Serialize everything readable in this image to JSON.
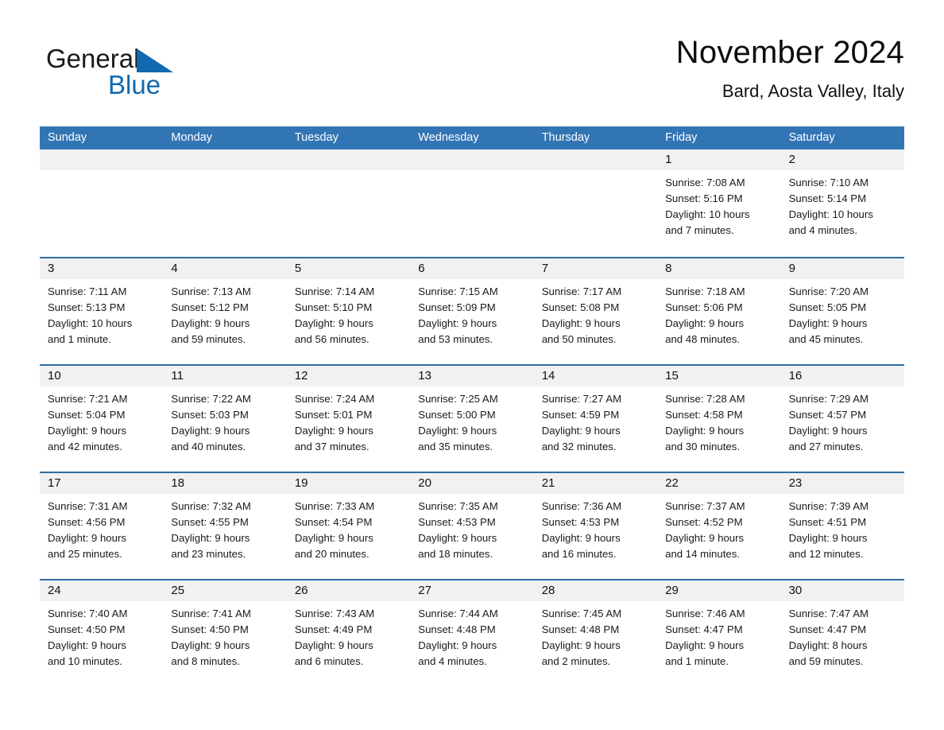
{
  "logo": {
    "word1": "General",
    "word2": "Blue",
    "triangle_icon": "blue-triangle-icon",
    "blue": "#1169b0"
  },
  "header": {
    "title": "November 2024",
    "subtitle": "Bard, Aosta Valley, Italy"
  },
  "theme": {
    "header_blue": "#3275b4",
    "row_rule_blue": "#2e6da4",
    "daynum_band": "#f1f1f1",
    "text": "#1a1a1a"
  },
  "weekdays": [
    "Sunday",
    "Monday",
    "Tuesday",
    "Wednesday",
    "Thursday",
    "Friday",
    "Saturday"
  ],
  "weeks": [
    [
      {
        "day": "",
        "lines": []
      },
      {
        "day": "",
        "lines": []
      },
      {
        "day": "",
        "lines": []
      },
      {
        "day": "",
        "lines": []
      },
      {
        "day": "",
        "lines": []
      },
      {
        "day": "1",
        "lines": [
          "Sunrise: 7:08 AM",
          "Sunset: 5:16 PM",
          "Daylight: 10 hours",
          "and 7 minutes."
        ]
      },
      {
        "day": "2",
        "lines": [
          "Sunrise: 7:10 AM",
          "Sunset: 5:14 PM",
          "Daylight: 10 hours",
          "and 4 minutes."
        ]
      }
    ],
    [
      {
        "day": "3",
        "lines": [
          "Sunrise: 7:11 AM",
          "Sunset: 5:13 PM",
          "Daylight: 10 hours",
          "and 1 minute."
        ]
      },
      {
        "day": "4",
        "lines": [
          "Sunrise: 7:13 AM",
          "Sunset: 5:12 PM",
          "Daylight: 9 hours",
          "and 59 minutes."
        ]
      },
      {
        "day": "5",
        "lines": [
          "Sunrise: 7:14 AM",
          "Sunset: 5:10 PM",
          "Daylight: 9 hours",
          "and 56 minutes."
        ]
      },
      {
        "day": "6",
        "lines": [
          "Sunrise: 7:15 AM",
          "Sunset: 5:09 PM",
          "Daylight: 9 hours",
          "and 53 minutes."
        ]
      },
      {
        "day": "7",
        "lines": [
          "Sunrise: 7:17 AM",
          "Sunset: 5:08 PM",
          "Daylight: 9 hours",
          "and 50 minutes."
        ]
      },
      {
        "day": "8",
        "lines": [
          "Sunrise: 7:18 AM",
          "Sunset: 5:06 PM",
          "Daylight: 9 hours",
          "and 48 minutes."
        ]
      },
      {
        "day": "9",
        "lines": [
          "Sunrise: 7:20 AM",
          "Sunset: 5:05 PM",
          "Daylight: 9 hours",
          "and 45 minutes."
        ]
      }
    ],
    [
      {
        "day": "10",
        "lines": [
          "Sunrise: 7:21 AM",
          "Sunset: 5:04 PM",
          "Daylight: 9 hours",
          "and 42 minutes."
        ]
      },
      {
        "day": "11",
        "lines": [
          "Sunrise: 7:22 AM",
          "Sunset: 5:03 PM",
          "Daylight: 9 hours",
          "and 40 minutes."
        ]
      },
      {
        "day": "12",
        "lines": [
          "Sunrise: 7:24 AM",
          "Sunset: 5:01 PM",
          "Daylight: 9 hours",
          "and 37 minutes."
        ]
      },
      {
        "day": "13",
        "lines": [
          "Sunrise: 7:25 AM",
          "Sunset: 5:00 PM",
          "Daylight: 9 hours",
          "and 35 minutes."
        ]
      },
      {
        "day": "14",
        "lines": [
          "Sunrise: 7:27 AM",
          "Sunset: 4:59 PM",
          "Daylight: 9 hours",
          "and 32 minutes."
        ]
      },
      {
        "day": "15",
        "lines": [
          "Sunrise: 7:28 AM",
          "Sunset: 4:58 PM",
          "Daylight: 9 hours",
          "and 30 minutes."
        ]
      },
      {
        "day": "16",
        "lines": [
          "Sunrise: 7:29 AM",
          "Sunset: 4:57 PM",
          "Daylight: 9 hours",
          "and 27 minutes."
        ]
      }
    ],
    [
      {
        "day": "17",
        "lines": [
          "Sunrise: 7:31 AM",
          "Sunset: 4:56 PM",
          "Daylight: 9 hours",
          "and 25 minutes."
        ]
      },
      {
        "day": "18",
        "lines": [
          "Sunrise: 7:32 AM",
          "Sunset: 4:55 PM",
          "Daylight: 9 hours",
          "and 23 minutes."
        ]
      },
      {
        "day": "19",
        "lines": [
          "Sunrise: 7:33 AM",
          "Sunset: 4:54 PM",
          "Daylight: 9 hours",
          "and 20 minutes."
        ]
      },
      {
        "day": "20",
        "lines": [
          "Sunrise: 7:35 AM",
          "Sunset: 4:53 PM",
          "Daylight: 9 hours",
          "and 18 minutes."
        ]
      },
      {
        "day": "21",
        "lines": [
          "Sunrise: 7:36 AM",
          "Sunset: 4:53 PM",
          "Daylight: 9 hours",
          "and 16 minutes."
        ]
      },
      {
        "day": "22",
        "lines": [
          "Sunrise: 7:37 AM",
          "Sunset: 4:52 PM",
          "Daylight: 9 hours",
          "and 14 minutes."
        ]
      },
      {
        "day": "23",
        "lines": [
          "Sunrise: 7:39 AM",
          "Sunset: 4:51 PM",
          "Daylight: 9 hours",
          "and 12 minutes."
        ]
      }
    ],
    [
      {
        "day": "24",
        "lines": [
          "Sunrise: 7:40 AM",
          "Sunset: 4:50 PM",
          "Daylight: 9 hours",
          "and 10 minutes."
        ]
      },
      {
        "day": "25",
        "lines": [
          "Sunrise: 7:41 AM",
          "Sunset: 4:50 PM",
          "Daylight: 9 hours",
          "and 8 minutes."
        ]
      },
      {
        "day": "26",
        "lines": [
          "Sunrise: 7:43 AM",
          "Sunset: 4:49 PM",
          "Daylight: 9 hours",
          "and 6 minutes."
        ]
      },
      {
        "day": "27",
        "lines": [
          "Sunrise: 7:44 AM",
          "Sunset: 4:48 PM",
          "Daylight: 9 hours",
          "and 4 minutes."
        ]
      },
      {
        "day": "28",
        "lines": [
          "Sunrise: 7:45 AM",
          "Sunset: 4:48 PM",
          "Daylight: 9 hours",
          "and 2 minutes."
        ]
      },
      {
        "day": "29",
        "lines": [
          "Sunrise: 7:46 AM",
          "Sunset: 4:47 PM",
          "Daylight: 9 hours",
          "and 1 minute."
        ]
      },
      {
        "day": "30",
        "lines": [
          "Sunrise: 7:47 AM",
          "Sunset: 4:47 PM",
          "Daylight: 8 hours",
          "and 59 minutes."
        ]
      }
    ]
  ]
}
